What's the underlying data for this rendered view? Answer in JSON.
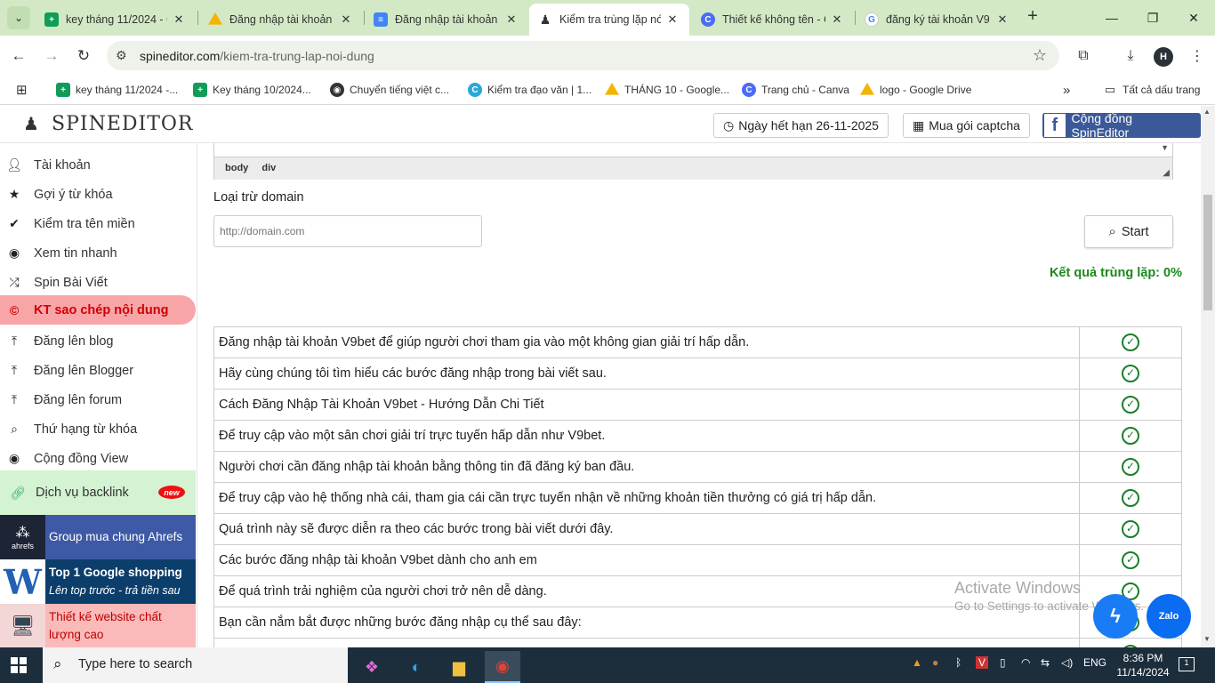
{
  "browser": {
    "tabs": [
      {
        "title": "key tháng 11/2024 - G",
        "icon": "sheets-icon",
        "color": "#0f9d58"
      },
      {
        "title": "Đăng nhập tài khoản",
        "icon": "drive-icon",
        "color": "#f4b400"
      },
      {
        "title": "Đăng nhập tài khoản",
        "icon": "docs-icon",
        "color": "#4285f4"
      },
      {
        "title": "Kiểm tra trùng lặp nó",
        "icon": "spy-icon",
        "color": "#333333"
      },
      {
        "title": "Thiết kế không tên - C",
        "icon": "canva-icon",
        "color": "#4a6cf7"
      },
      {
        "title": "đăng ký tài khoản V9",
        "icon": "google-icon",
        "color": "#4285f4"
      }
    ],
    "url_host": "spineditor.com",
    "url_path": "/kiem-tra-trung-lap-noi-dung",
    "profile_initial": "H",
    "bookmarks": [
      {
        "label": "key tháng 11/2024 -...",
        "icon": "sheets-icon",
        "color": "#0f9d58"
      },
      {
        "label": "Key tháng 10/2024...",
        "icon": "sheets-icon",
        "color": "#0f9d58"
      },
      {
        "label": "Chuyển tiếng việt c...",
        "icon": "globe-icon",
        "color": "#333333"
      },
      {
        "label": "Kiểm tra đạo văn | 1...",
        "icon": "c-icon",
        "color": "#2aa8d8"
      },
      {
        "label": "THÁNG 10 - Google...",
        "icon": "drive-icon",
        "color": "#f4b400"
      },
      {
        "label": "Trang chủ - Canva",
        "icon": "canva-icon",
        "color": "#4a6cf7"
      },
      {
        "label": "logo - Google Drive",
        "icon": "drive-icon",
        "color": "#f4b400"
      }
    ],
    "all_bookmarks": "Tất cả dấu trang"
  },
  "header": {
    "logo_text": "SPINEDITOR",
    "expiry_label": "Ngày hết hạn 26-11-2025",
    "captcha_label": "Mua gói captcha",
    "community_label": "Cộng đồng SpinEditor"
  },
  "sidebar": {
    "items": [
      {
        "label": "Tài khoản",
        "icon": "user-icon"
      },
      {
        "label": "Gợi ý từ khóa",
        "icon": "star-icon"
      },
      {
        "label": "Kiểm tra tên miền",
        "icon": "check-icon"
      },
      {
        "label": "Xem tin nhanh",
        "icon": "eye-icon"
      },
      {
        "label": "Spin Bài Viết",
        "icon": "shuffle-icon"
      },
      {
        "label": "KT sao chép nội dung",
        "icon": "copyright-icon",
        "active": true
      },
      {
        "label": "Đăng lên blog",
        "icon": "upload-icon"
      },
      {
        "label": "Đăng lên Blogger",
        "icon": "upload-icon"
      },
      {
        "label": "Đăng lên forum",
        "icon": "upload-icon"
      },
      {
        "label": "Thứ hạng từ khóa",
        "icon": "search-icon"
      },
      {
        "label": "Cộng đồng View",
        "icon": "eye-icon"
      }
    ],
    "backlink_label": "Dịch vụ backlink",
    "new_badge": "new",
    "ads": {
      "ahrefs_logo": "ahrefs",
      "ahrefs_label": "Group mua chung Ahrefs",
      "shopping_line1": "Top 1 Google shopping",
      "shopping_line2": "Lên top trước - trả tiền sau",
      "website_label": "Thiết kế website chất lượng cao"
    }
  },
  "editor": {
    "path": [
      "body",
      "div"
    ]
  },
  "form": {
    "exclude_label": "Loại trừ domain",
    "domain_placeholder": "http://domain.com",
    "start_label": "Start",
    "result_label": "Kết quả trùng lặp: 0%"
  },
  "rows": [
    "Đăng nhập tài khoản V9bet để giúp người chơi tham gia vào một không gian giải trí hấp dẫn.",
    "Hãy cùng chúng tôi tìm hiểu các bước đăng nhập trong bài viết sau.",
    "Cách Đăng Nhập Tài Khoản V9bet - Hướng Dẫn Chi Tiết",
    "Để truy cập vào một sân chơi giải trí trực tuyến hấp dẫn như V9bet.",
    "Người chơi cần đăng nhập tài khoản bằng thông tin đã đăng ký ban đầu.",
    "Để truy cập vào hệ thống nhà cái, tham gia cái cần trực tuyến nhận về những khoản tiền thưởng có giá trị hấp dẫn.",
    "Quá trình này sẽ được diễn ra theo các bước trong bài viết dưới đây.",
    "Các bước đăng nhập tài khoản V9bet dành cho anh em",
    "Để quá trình trải nghiệm của người chơi trở nên dễ dàng.",
    "Bạn cần nắm bắt được những bước đăng nhập cụ thể sau đây:",
    ""
  ],
  "watermark": {
    "line1": "Activate Windows",
    "line2": "Go to Settings to activate Windows."
  },
  "chat": {
    "zalo_label": "Zalo"
  },
  "taskbar": {
    "search_placeholder": "Type here to search",
    "language": "ENG",
    "time": "8:36 PM",
    "date": "11/14/2024",
    "notifications": "1"
  }
}
